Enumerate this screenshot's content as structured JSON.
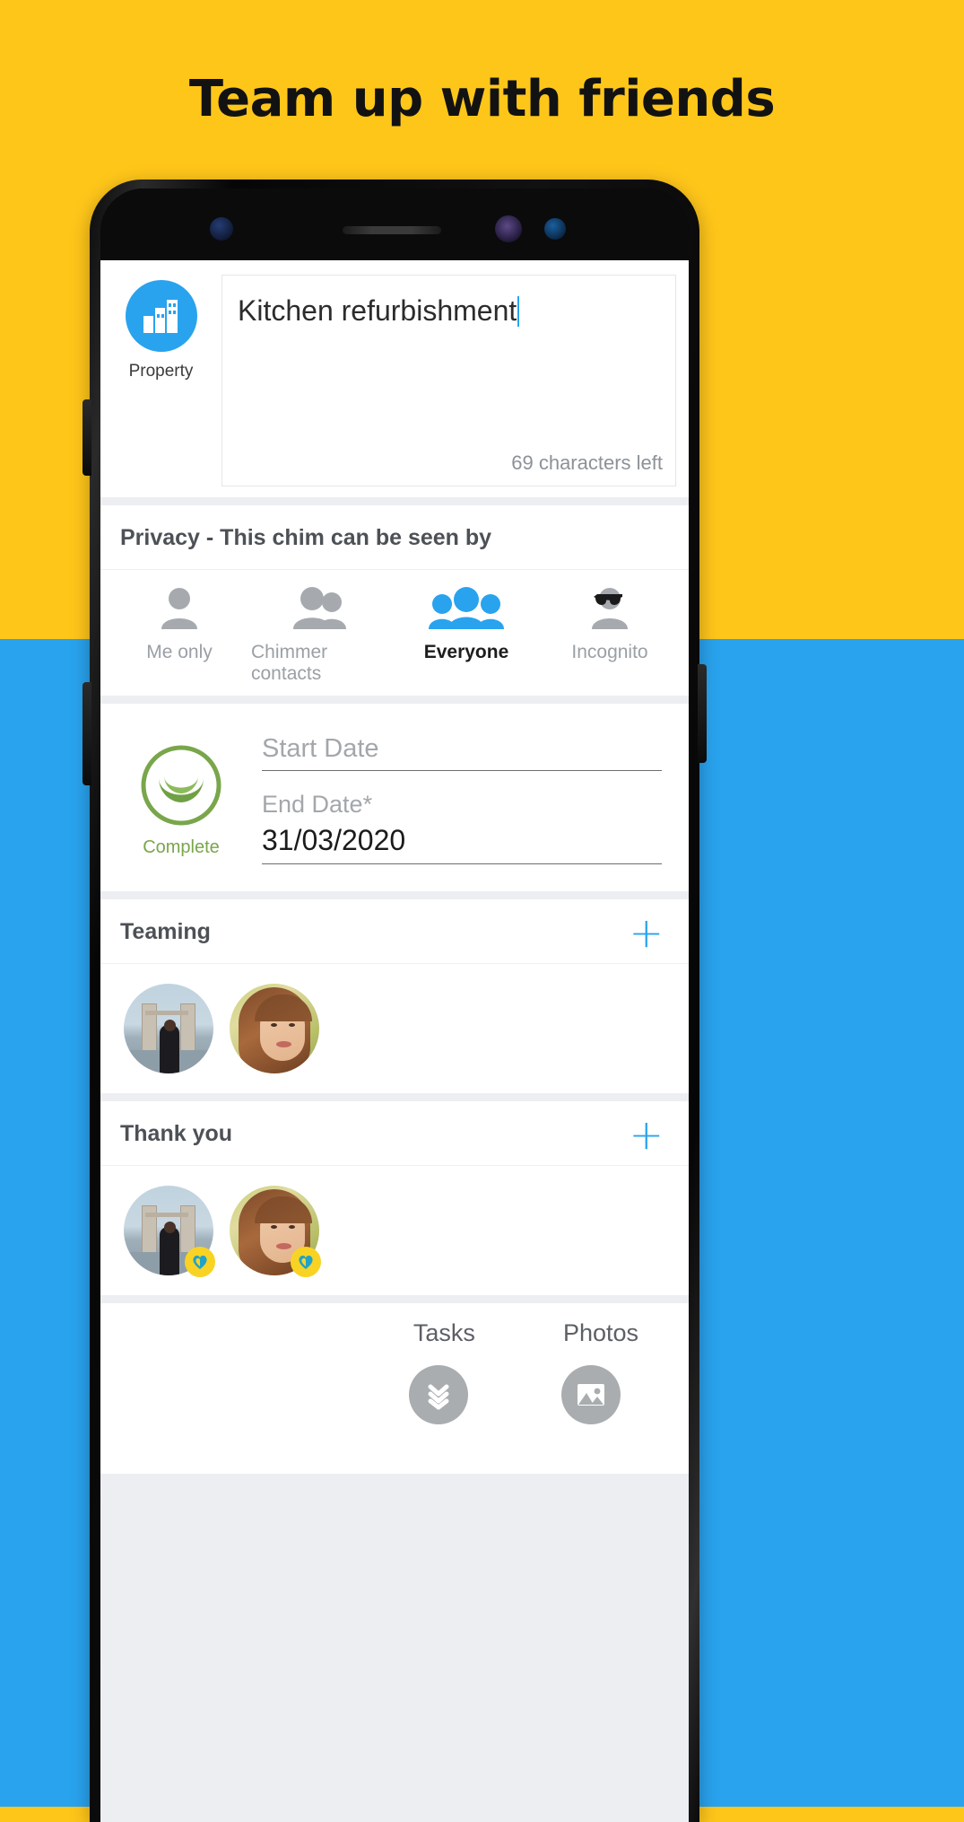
{
  "headline": "Team up with friends",
  "colors": {
    "top_background": "#FFC61A",
    "bottom_background": "#29A3EE",
    "accent_blue": "#29A3EE",
    "complete_green": "#79A64B",
    "badge_yellow": "#F8D324"
  },
  "app": {
    "category": {
      "label": "Property",
      "icon": "building-bars-icon"
    },
    "title_input": {
      "value": "Kitchen refurbishment",
      "characters_left": "69 characters left"
    },
    "privacy": {
      "heading": "Privacy - This chim can be seen by",
      "options": [
        {
          "label": "Me only",
          "icon": "single-person-icon",
          "selected": false
        },
        {
          "label": "Chimmer contacts",
          "icon": "two-people-icon",
          "selected": false
        },
        {
          "label": "Everyone",
          "icon": "three-people-icon",
          "selected": true
        },
        {
          "label": "Incognito",
          "icon": "sunglasses-person-icon",
          "selected": false
        }
      ]
    },
    "dates": {
      "status_label": "Complete",
      "status_icon": "complete-crescent-icon",
      "start_date": {
        "placeholder": "Start Date",
        "value": ""
      },
      "end_date": {
        "label": "End Date*",
        "value": "31/03/2020"
      }
    },
    "teaming": {
      "heading": "Teaming",
      "add_label": "+",
      "members": [
        {
          "name": "tower-bridge-avatar",
          "badge": false
        },
        {
          "name": "woman-avatar",
          "badge": false
        }
      ]
    },
    "thank_you": {
      "heading": "Thank you",
      "add_label": "+",
      "members": [
        {
          "name": "tower-bridge-avatar",
          "badge": true
        },
        {
          "name": "woman-avatar",
          "badge": true
        }
      ]
    },
    "bottom_bar": {
      "items": [
        {
          "label": "Tasks",
          "icon": "double-chevron-down-icon"
        },
        {
          "label": "Photos",
          "icon": "image-icon"
        }
      ]
    }
  }
}
